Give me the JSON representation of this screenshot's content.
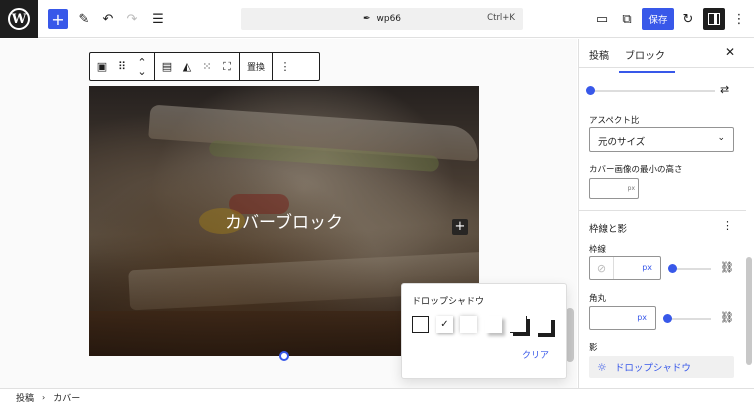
{
  "topbar": {
    "logo_icon": "wordpress-logo",
    "logo_text": "W",
    "add_icon": "+",
    "tools_icon": "✎",
    "undo_icon": "↶",
    "redo_icon": "↷",
    "outline_icon": "☰",
    "doc_icon": "✒",
    "doc_title": "wp66",
    "shortcut": "Ctrl+K",
    "view_icon": "▭",
    "external_icon": "⧉",
    "save_label": "保存",
    "revisions_icon": "↻",
    "more_icon": "⋮"
  },
  "block_toolbar": {
    "cover_icon": "▣",
    "drag_icon": "⠿",
    "move_up_icon": "⌃",
    "move_down_icon": "⌄",
    "align_icon": "▤",
    "contrast_icon": "◭",
    "focal_icon": "⁙",
    "fullscreen_icon": "⛶",
    "replace_label": "置換",
    "options_icon": "⋮"
  },
  "cover": {
    "title": "カバーブロック",
    "add_icon": "+"
  },
  "shadow_popover": {
    "title": "ドロップシャドウ",
    "selected_check": "✓",
    "clear_label": "クリア"
  },
  "sidebar": {
    "tab_post": "投稿",
    "tab_block": "ブロック",
    "close_icon": "✕",
    "settings_icon": "⇄",
    "aspect_label": "アスペクト比",
    "aspect_value": "元のサイズ",
    "chevron_icon": "⌄",
    "min_height_label": "カバー画像の最小の高さ",
    "min_height_unit": "px",
    "section_border_shadow": "枠線と影",
    "section_more_icon": "⋮",
    "border_label": "枠線",
    "border_unit": "px",
    "border_color_icon": "⊘",
    "radius_label": "角丸",
    "radius_unit": "px",
    "link_icon": "⛓",
    "shadow_label": "影",
    "shadow_button_label": "ドロップシャドウ",
    "shadow_icon": "☼"
  },
  "footer": {
    "crumb_post": "投稿",
    "separator": "›",
    "crumb_cover": "カバー"
  },
  "colors": {
    "accent": "#3858e9",
    "dark": "#1e1e1e"
  }
}
